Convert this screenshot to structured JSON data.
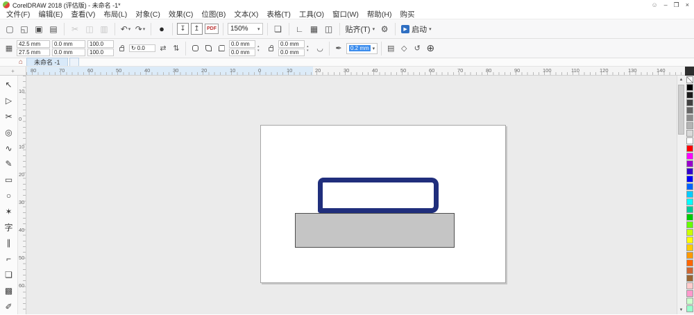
{
  "window": {
    "title": "CorelDRAW 2018 (评估版) - 未命名 -1*",
    "controls": {
      "account": "☺",
      "minimize": "–",
      "restore": "❐",
      "close": "×"
    }
  },
  "menu": {
    "items": [
      "文件(F)",
      "编辑(E)",
      "查看(V)",
      "布局(L)",
      "对象(C)",
      "效果(C)",
      "位图(B)",
      "文本(X)",
      "表格(T)",
      "工具(O)",
      "窗口(W)",
      "帮助(H)",
      "购买"
    ]
  },
  "toolbar": {
    "zoom_value": "150%",
    "items": [
      {
        "name": "new-document-button",
        "glyph": "▢"
      },
      {
        "name": "open-button",
        "glyph": "◱"
      },
      {
        "name": "save-button",
        "glyph": "▣"
      },
      {
        "name": "print-button",
        "glyph": "▤"
      },
      {
        "type": "sep"
      },
      {
        "name": "cut-button",
        "glyph": "✂",
        "disabled": true
      },
      {
        "name": "copy-button",
        "glyph": "◫",
        "disabled": true
      },
      {
        "name": "paste-button",
        "glyph": "▥",
        "disabled": true
      },
      {
        "type": "sep"
      },
      {
        "name": "undo-button",
        "glyph": "↶",
        "caret": true
      },
      {
        "name": "redo-button",
        "glyph": "↷",
        "caret": true
      },
      {
        "type": "sep"
      },
      {
        "name": "search-content-button",
        "glyph": "●",
        "dark": true
      },
      {
        "type": "sep"
      },
      {
        "name": "import-button",
        "glyph": "↧",
        "boxed": true
      },
      {
        "name": "export-button",
        "glyph": "↥",
        "boxed": true
      },
      {
        "name": "pdf-button",
        "glyph": "PDF",
        "pdf": true
      },
      {
        "type": "sep"
      },
      {
        "name": "zoom-level-combo",
        "type": "combo",
        "value": "150%"
      },
      {
        "type": "sep"
      },
      {
        "name": "fullscreen-preview-button",
        "glyph": "❏"
      },
      {
        "type": "sep"
      },
      {
        "name": "show-rulers-button",
        "glyph": "∟"
      },
      {
        "name": "show-grid-button",
        "glyph": "▦"
      },
      {
        "name": "show-guidelines-button",
        "glyph": "◫"
      },
      {
        "type": "sep"
      },
      {
        "name": "snap-dropdown",
        "type": "dropdown",
        "label": "贴齐(T)"
      },
      {
        "name": "options-button",
        "glyph": "⚙"
      },
      {
        "type": "sep"
      },
      {
        "name": "launch-dropdown",
        "type": "dropdown",
        "label": "启动",
        "icon": "▶"
      }
    ]
  },
  "property_bar": {
    "position": {
      "x": "42.5 mm",
      "y": "27.5 mm"
    },
    "size": {
      "w": "0.0 mm",
      "h": "0.0 mm"
    },
    "scale": {
      "w": "100.0",
      "h": "100.0"
    },
    "angle": "0.0",
    "corners": [
      "0.0 mm",
      "0.0 mm",
      "0.0 mm",
      "0.0 mm"
    ],
    "outline_width": "0.2 mm",
    "icons": {
      "grid": "▦",
      "angle": "↻",
      "mirror_h": "⇄",
      "mirror_v": "⇅",
      "relative_corner": "◡",
      "pen": "✒",
      "wrap": "▤",
      "curves": "◇",
      "refresh": "↺",
      "add": "⊕"
    }
  },
  "tabs": {
    "home_icon": "⌂",
    "active_label": "未命名 -1"
  },
  "rulers": {
    "horizontal_labels": [
      "80",
      "70",
      "60",
      "50",
      "40",
      "30",
      "20",
      "10",
      "0",
      "10",
      "20",
      "30",
      "40",
      "50",
      "60",
      "70",
      "80",
      "90",
      "100",
      "110",
      "120",
      "130",
      "140"
    ],
    "vertical_labels": [
      "10",
      "0",
      "10",
      "20",
      "30",
      "40",
      "50",
      "60"
    ]
  },
  "toolbox": {
    "tools": [
      {
        "name": "pick-tool",
        "glyph": "↖"
      },
      {
        "name": "shape-tool",
        "glyph": "▷"
      },
      {
        "name": "crop-tool",
        "glyph": "✂"
      },
      {
        "name": "zoom-tool",
        "glyph": "◎"
      },
      {
        "name": "freehand-tool",
        "glyph": "∿"
      },
      {
        "name": "artistic-media-tool",
        "glyph": "✎"
      },
      {
        "name": "rectangle-tool",
        "glyph": "▭"
      },
      {
        "name": "ellipse-tool",
        "glyph": "○"
      },
      {
        "name": "polygon-tool",
        "glyph": "✶"
      },
      {
        "name": "text-tool",
        "glyph": "字"
      },
      {
        "name": "parallel-dimension-tool",
        "glyph": "∥"
      },
      {
        "name": "connector-tool",
        "glyph": "⌐"
      },
      {
        "name": "drop-shadow-tool",
        "glyph": "❏"
      },
      {
        "name": "transparency-tool",
        "glyph": "▩"
      },
      {
        "name": "color-eyedropper-tool",
        "glyph": "✐"
      }
    ]
  },
  "canvas": {
    "page": {
      "fill": "#ffffff",
      "border": "#a6a6a6"
    },
    "shapes": [
      {
        "name": "base-rectangle",
        "fill": "#c5c5c5",
        "stroke": "#4d4d4d"
      },
      {
        "name": "lid-rounded-rectangle",
        "fill": "#ffffff",
        "stroke": "#202e7c"
      }
    ]
  },
  "palette": {
    "colors": [
      "#000000",
      "#1a1a1a",
      "#404040",
      "#666666",
      "#8c8c8c",
      "#b3b3b3",
      "#d9d9d9",
      "#ffffff",
      "#ff0000",
      "#ff00ff",
      "#9900cc",
      "#3300cc",
      "#0000ff",
      "#0066ff",
      "#00ccff",
      "#00ffff",
      "#00cc99",
      "#00cc00",
      "#66ff00",
      "#ccff00",
      "#ffff00",
      "#ffcc00",
      "#ff9900",
      "#ff6600",
      "#cc6633",
      "#996633",
      "#ffcccc",
      "#ff99cc",
      "#ccffcc",
      "#99ffcc"
    ]
  },
  "scrollbar": {
    "up": "▲",
    "down": "▼"
  }
}
